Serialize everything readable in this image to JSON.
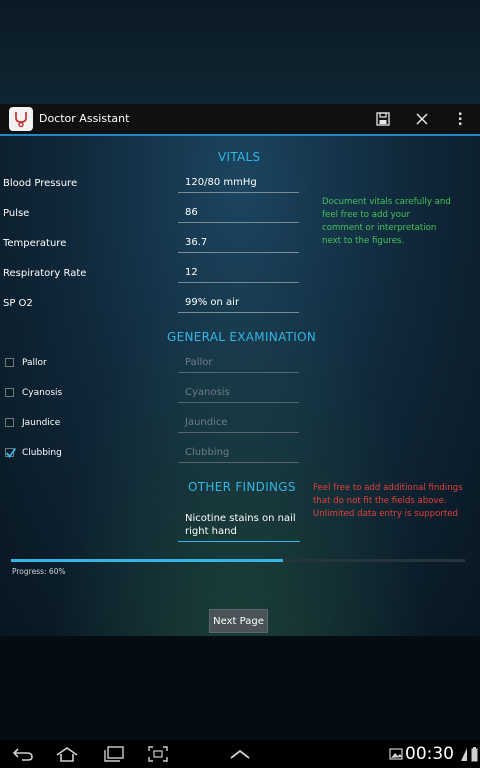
{
  "app": {
    "title": "Doctor Assistant"
  },
  "vitals": {
    "title": "VITALS",
    "rows": [
      {
        "label": "Blood Pressure",
        "value": "120/80 mmHg"
      },
      {
        "label": "Pulse",
        "value": "86"
      },
      {
        "label": "Temperature",
        "value": "36.7"
      },
      {
        "label": "Respiratory Rate",
        "value": "12"
      },
      {
        "label": "SP O2",
        "value": "99% on air"
      }
    ],
    "note": "Document vitals carefully and feel free to add your comment or interpretation next to the figures."
  },
  "general_exam": {
    "title": "GENERAL EXAMINATION",
    "rows": [
      {
        "label": "Pallor",
        "placeholder": "Pallor",
        "checked": false
      },
      {
        "label": "Cyanosis",
        "placeholder": "Cyanosis",
        "checked": false
      },
      {
        "label": "Jaundice",
        "placeholder": "Jaundice",
        "checked": false
      },
      {
        "label": "Clubbing",
        "placeholder": "Clubbing",
        "checked": true
      }
    ]
  },
  "other_findings": {
    "title": "OTHER FINDINGS",
    "value_line1": "Nicotine stains on nail",
    "value_line2": "right hand",
    "note": "Feel free to add additional findings that do not fit the fields above. Unlimited data entry is supported"
  },
  "progress": {
    "label": "Progress: 60%",
    "fraction": 0.6
  },
  "next_button": "Next Page",
  "status": {
    "time": "00:30"
  },
  "colors": {
    "accent": "#33b5e5",
    "note_green": "#43c35a",
    "note_red": "#e0403a"
  },
  "icons": [
    "app-stethoscope-icon",
    "save-icon",
    "close-icon",
    "overflow-menu-icon",
    "back-icon",
    "home-icon",
    "recent-apps-icon",
    "screenshot-icon",
    "up-caret-icon",
    "gallery-icon",
    "wifi-icon",
    "battery-icon"
  ]
}
